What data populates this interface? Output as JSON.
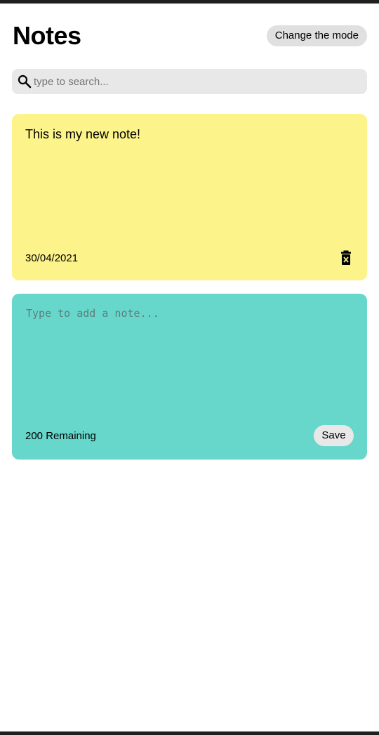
{
  "header": {
    "title": "Notes",
    "mode_button_label": "Change the mode"
  },
  "search": {
    "icon": "search-icon",
    "placeholder": "type to search..."
  },
  "notes": [
    {
      "text": "This is my new note!",
      "date": "30/04/2021",
      "color": "#fcf38b",
      "delete_icon": "trash-icon"
    }
  ],
  "add_note": {
    "placeholder": "Type to add a note...",
    "remaining_label": "200 Remaining",
    "save_label": "Save",
    "color": "#67d7cc"
  }
}
